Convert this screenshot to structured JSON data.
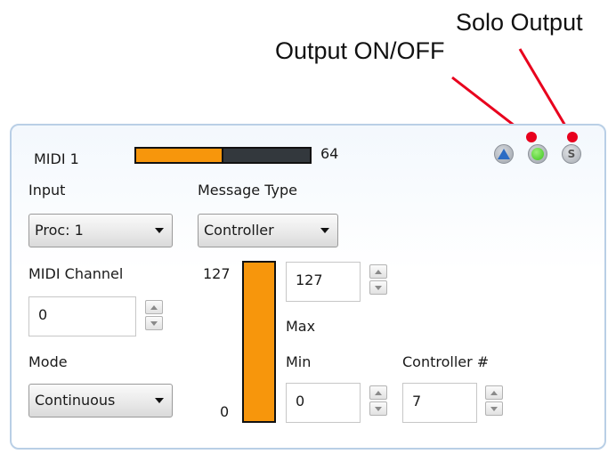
{
  "annotations": {
    "solo_output": "Solo Output",
    "output_on_off": "Output ON/OFF"
  },
  "header": {
    "title": "MIDI 1",
    "level_value": "64",
    "level_fraction": 0.5
  },
  "buttons": {
    "up_icon": "up-triangle-icon",
    "output_icon": "green-led-icon",
    "solo_label": "S"
  },
  "input": {
    "label": "Input",
    "value": "Proc: 1"
  },
  "message_type": {
    "label": "Message Type",
    "value": "Controller"
  },
  "midi_channel": {
    "label": "MIDI Channel",
    "value": "0"
  },
  "mode": {
    "label": "Mode",
    "value": "Continuous"
  },
  "range_bar": {
    "max_label": "127",
    "min_label": "0",
    "fill_fraction": 1.0
  },
  "max": {
    "label": "Max",
    "value": "127"
  },
  "min": {
    "label": "Min",
    "value": "0"
  },
  "controller": {
    "label": "Controller #",
    "value": "7"
  },
  "colors": {
    "accent": "#f7960c",
    "bar_bg": "#33383d",
    "marker": "#e8001d",
    "led": "#3cc41c"
  }
}
